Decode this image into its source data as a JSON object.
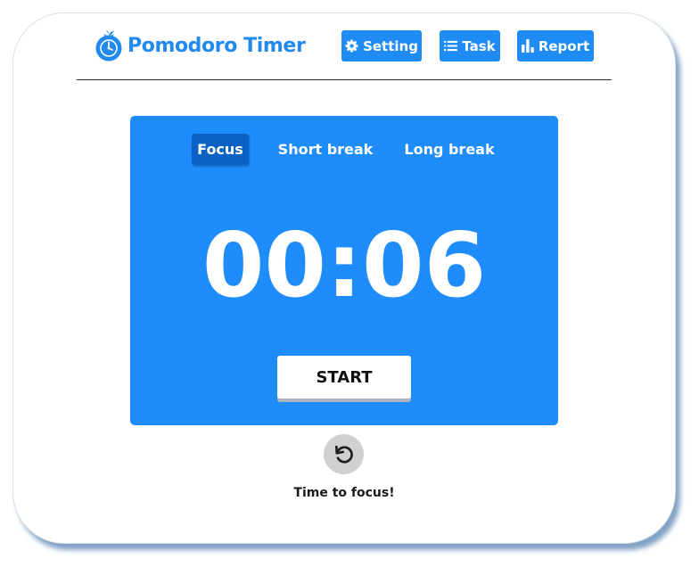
{
  "app": {
    "title": "Pomodoro Timer",
    "icon": "tomato-timer-icon"
  },
  "nav": {
    "setting": {
      "label": "Setting",
      "icon": "gear-icon"
    },
    "task": {
      "label": "Task",
      "icon": "list-icon"
    },
    "report": {
      "label": "Report",
      "icon": "bar-chart-icon"
    }
  },
  "timer": {
    "modes": [
      {
        "label": "Focus",
        "active": true
      },
      {
        "label": "Short break",
        "active": false
      },
      {
        "label": "Long break",
        "active": false
      }
    ],
    "time": "00:06",
    "start_label": "START",
    "reset_icon": "reset-icon"
  },
  "status": {
    "message": "Time to focus!"
  },
  "colors": {
    "accent": "#2289ee",
    "button": "#1f8cf6",
    "panel": "#1f8cfc",
    "active_tab": "#0a63c2",
    "reset_bg": "#d0d0d0"
  }
}
